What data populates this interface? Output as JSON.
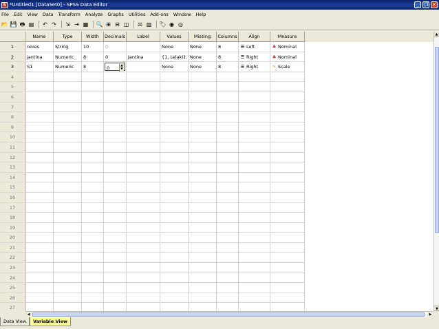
{
  "window": {
    "title": "*Untitled1 [DataSet0] - SPSS Data Editor",
    "app_icon": "spss-app-icon",
    "controls": [
      "minimize",
      "restore",
      "close"
    ]
  },
  "menu": [
    "File",
    "Edit",
    "View",
    "Data",
    "Transform",
    "Analyze",
    "Graphs",
    "Utilities",
    "Add-ons",
    "Window",
    "Help"
  ],
  "toolbar_icons": [
    "open-icon",
    "save-icon",
    "print-icon",
    "dialog-recall-icon",
    "undo-icon",
    "redo-icon",
    "goto-case-icon",
    "goto-variable-icon",
    "variables-icon",
    "find-icon",
    "insert-cases-icon",
    "insert-variable-icon",
    "split-file-icon",
    "weight-cases-icon",
    "select-cases-icon",
    "value-labels-icon",
    "use-sets-icon",
    "show-all-icon"
  ],
  "columns": [
    "Name",
    "Type",
    "Width",
    "Decimals",
    "Label",
    "Values",
    "Missing",
    "Columns",
    "Align",
    "Measure"
  ],
  "rows": [
    {
      "num": "1",
      "name": "nores",
      "type": "String",
      "width": "10",
      "decimals": "0",
      "label": "",
      "values": "None",
      "missing": "None",
      "columns": "8",
      "align": "Left",
      "measure": "Nominal"
    },
    {
      "num": "2",
      "name": "jantina",
      "type": "Numeric",
      "width": "8",
      "decimals": "0",
      "label": "Jantina",
      "values": "{1, Lelaki}...",
      "missing": "None",
      "columns": "8",
      "align": "Right",
      "measure": "Nominal"
    },
    {
      "num": "3",
      "name": "S1",
      "type": "Numeric",
      "width": "8",
      "decimals": "0",
      "label": "",
      "values": "None",
      "missing": "None",
      "columns": "8",
      "align": "Right",
      "measure": "Scale"
    }
  ],
  "empty_rows": [
    "4",
    "5",
    "6",
    "7",
    "8",
    "9",
    "10",
    "11",
    "12",
    "13",
    "14",
    "15",
    "16",
    "17",
    "18",
    "19",
    "20",
    "21",
    "22",
    "23",
    "24",
    "25",
    "26",
    "27"
  ],
  "tabs": [
    "Data View",
    "Variable View"
  ],
  "active_tab": "Variable View"
}
